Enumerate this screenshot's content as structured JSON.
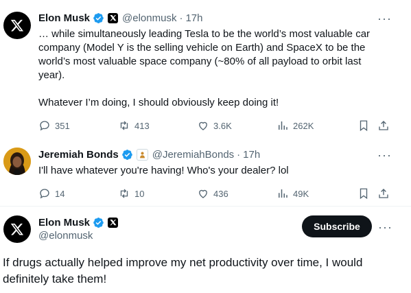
{
  "tweet1": {
    "name": "Elon Musk",
    "handle": "@elonmusk",
    "separator": "·",
    "time": "17h",
    "more": "···",
    "text_line1": "… while simultaneously leading Tesla to be the world’s most valuable car",
    "text_line2": "company (Model Y is the selling vehicle on Earth) and SpaceX to be the",
    "text_line3": "world’s most valuable space company (~80% of all payload to orbit last",
    "text_line4": "year).",
    "text_line5": "Whatever I’m doing, I should obviously keep doing it!",
    "actions": {
      "replies": "351",
      "reposts": "413",
      "likes": "3.6K",
      "views": "262K"
    }
  },
  "tweet2": {
    "name": "Jeremiah Bonds",
    "handle": "@JeremiahBonds",
    "separator": "·",
    "time": "17h",
    "more": "···",
    "text": "I'll have whatever you're having! Who's your dealer? lol",
    "actions": {
      "replies": "14",
      "reposts": "10",
      "likes": "436",
      "views": "49K"
    }
  },
  "tweet3": {
    "name": "Elon Musk",
    "handle": "@elonmusk",
    "subscribe_label": "Subscribe",
    "more": "···",
    "text_line1": "If drugs actually helped improve my net productivity over time, I would",
    "text_line2": "definitely take them!"
  },
  "colors": {
    "text": "#0f1419",
    "muted": "#536471",
    "verified": "#1d9bf0",
    "button_bg": "#0f1419"
  }
}
